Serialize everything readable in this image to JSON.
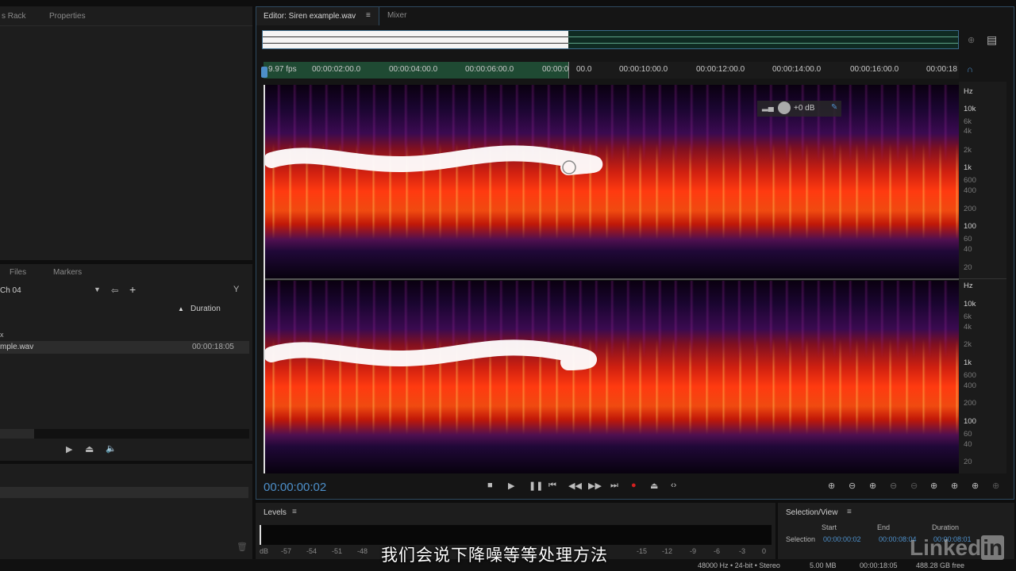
{
  "left_top_panel": {
    "tabs": [
      "s Rack",
      "Properties"
    ]
  },
  "files_panel": {
    "tabs": [
      "Files",
      "Markers"
    ],
    "dropdown_value": "Ch 04",
    "column_header": "Duration",
    "rows": [
      {
        "name": "x",
        "duration": ""
      },
      {
        "name": "mple.wav",
        "duration": "00:00:18:05"
      }
    ]
  },
  "editor": {
    "tabs": [
      "Editor: Siren example.wav",
      "Mixer"
    ],
    "ruler": {
      "fps": "9.97 fps",
      "ticks": [
        "00:00:02:00.0",
        "00:00:04:00.0",
        "00:00:06:00.0",
        "00:00:0",
        "00.0",
        "00:00:10:00.0",
        "00:00:12:00.0",
        "00:00:14:00.0",
        "00:00:16:00.0",
        "00:00:18"
      ]
    },
    "hud_gain": "+0 dB",
    "hz_unit": "Hz",
    "hz_labels": [
      "10k",
      "6k",
      "4k",
      "2k",
      "1k",
      "600",
      "400",
      "200",
      "100",
      "60",
      "40",
      "20"
    ],
    "current_time": "00:00:00:02",
    "selection_progress_percent": 44
  },
  "levels": {
    "title": "Levels",
    "scale": [
      "dB",
      "-57",
      "-54",
      "-51",
      "-48",
      "-15",
      "-12",
      "-9",
      "-6",
      "-3",
      "0"
    ]
  },
  "selection_view": {
    "title": "Selection/View",
    "headers": [
      "Start",
      "End",
      "Duration"
    ],
    "row_label": "Selection",
    "start": "00:00:00:02",
    "end": "00:00:08:04",
    "duration": "00:00:08:01"
  },
  "status_bar": {
    "format": "48000 Hz • 24-bit • Stereo",
    "size": "5.00 MB",
    "duration": "00:00:18:05",
    "free": "488.28 GB free"
  },
  "subtitle": "我们会说下降噪等等处理方法",
  "watermark": "LinkedIn",
  "colors": {
    "accent": "#4d8fc9",
    "record": "#d42020",
    "selection": "#1f4a33"
  }
}
